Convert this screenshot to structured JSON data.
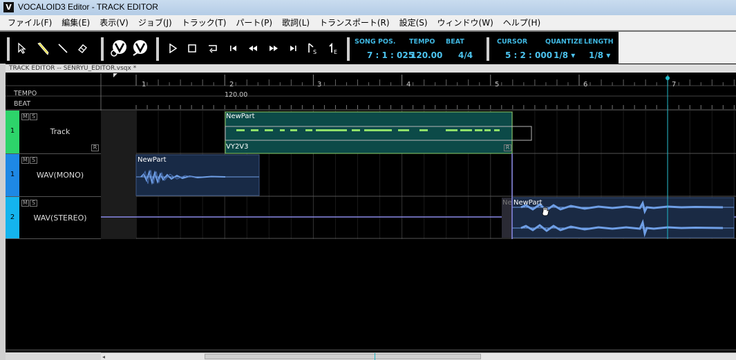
{
  "window": {
    "title": "VOCALOID3 Editor - TRACK EDITOR",
    "app_icon_letter": "V"
  },
  "menu": [
    "ファイル(F)",
    "編集(E)",
    "表示(V)",
    "ジョブ(J)",
    "トラック(T)",
    "パート(P)",
    "歌詞(L)",
    "トランスポート(R)",
    "設定(S)",
    "ウィンドウ(W)",
    "ヘルプ(H)"
  ],
  "toolbar": {
    "tools": [
      "arrow-tool-icon",
      "pencil-tool-icon",
      "line-tool-icon",
      "eraser-tool-icon"
    ],
    "transport": [
      "play-icon",
      "stop-icon",
      "loop-icon",
      "go-start-icon",
      "rewind-icon",
      "fast-forward-icon",
      "go-end-icon"
    ],
    "start_marker_sub": "S",
    "end_marker_sub": "E",
    "song_pos": {
      "label": "SONG POS.",
      "value": "7 : 1 : 025"
    },
    "tempo": {
      "label": "TEMPO",
      "value": "120.00"
    },
    "beat": {
      "label": "BEAT",
      "value": "4/4"
    },
    "cursor": {
      "label": "CURSOR",
      "value": "5 : 2 : 000"
    },
    "quantize": {
      "label": "QUANTIZE",
      "value": "1/8 ▾"
    },
    "length": {
      "label": "LENGTH",
      "value": "1/8 ▾"
    }
  },
  "editor": {
    "header": "TRACK EDITOR -- SENRYU_EDITOR.vsqx *",
    "ruler": {
      "tempo_label": "TEMPO",
      "beat_label": "BEAT",
      "tempo_value": "120.00",
      "bars": [
        "1",
        "2",
        "3",
        "4",
        "5",
        "6",
        "7"
      ]
    },
    "tracks": [
      {
        "num": "1",
        "name": "Track",
        "color": "#2dd46a",
        "m": "M",
        "s": "S",
        "r": "R",
        "part": {
          "label": "NewPart",
          "singer": "VY2V3",
          "r": "R"
        }
      },
      {
        "num": "1",
        "name": "WAV(MONO)",
        "color": "#1e88e5",
        "m": "M",
        "s": "S",
        "part": {
          "label": "NewPart"
        }
      },
      {
        "num": "2",
        "name": "WAV(STEREO)",
        "color": "#14b4ee",
        "m": "M",
        "s": "S",
        "part": {
          "label": "NewPart",
          "ghost_label": "Ne"
        }
      }
    ]
  },
  "colors": {
    "vocal_part_bg": "#0c4a48",
    "vocal_note": "#8fe06a",
    "wave_part_bg": "#182a46",
    "wave_color": "#6f9fe6",
    "playhead": "#1fb8c8",
    "cursor_line": "#8a8ae8"
  }
}
